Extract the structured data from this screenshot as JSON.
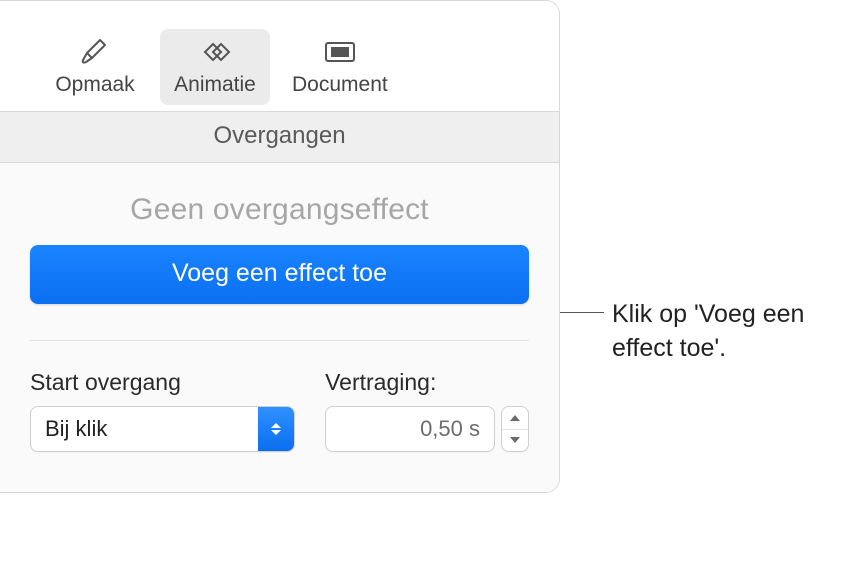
{
  "toolbar": {
    "opmaak": {
      "label": "Opmaak"
    },
    "animatie": {
      "label": "Animatie"
    },
    "document": {
      "label": "Document"
    }
  },
  "section": {
    "title": "Overgangen"
  },
  "body": {
    "no_effect": "Geen overgangseffect",
    "add_button": "Voeg een effect toe"
  },
  "controls": {
    "start": {
      "label": "Start overgang",
      "value": "Bij klik"
    },
    "delay": {
      "label": "Vertraging:",
      "value": "0,50 s"
    }
  },
  "callout": {
    "text": "Klik op 'Voeg een effect toe'."
  }
}
